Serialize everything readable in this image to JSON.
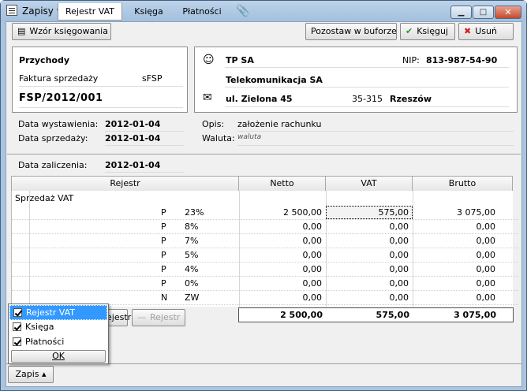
{
  "window": {
    "title": "Zapisy w buforze"
  },
  "toolbar": {
    "wzor": "Wzór księgowania",
    "pozostaw": "Pozostaw w buforze",
    "ksieguj": "Księguj",
    "usun": "Usuń"
  },
  "document": {
    "category": "Przychody",
    "type_label": "Faktura sprzedaży",
    "type_code": "sFSP",
    "number": "FSP/2012/001"
  },
  "contractor": {
    "name": "TP SA",
    "nip_label": "NIP:",
    "nip": "813-987-54-90",
    "full_name": "Telekomunikacja SA",
    "street": "ul. Zielona 45",
    "postal": "35-315",
    "city": "Rzeszów"
  },
  "dates": {
    "issue_label": "Data wystawienia:",
    "issue": "2012-01-04",
    "sale_label": "Data sprzedaży:",
    "sale": "2012-01-04",
    "booking_label": "Data zaliczenia:",
    "booking": "2012-01-04"
  },
  "meta": {
    "desc_label": "Opis:",
    "desc": "założenie rachunku",
    "currency_label": "Waluta:",
    "currency": "waluta"
  },
  "table": {
    "headers": {
      "rejestr": "Rejestr",
      "netto": "Netto",
      "vat": "VAT",
      "brutto": "Brutto"
    },
    "group": "Sprzedaż VAT",
    "rows": [
      {
        "flag": "P",
        "rate": "23%",
        "netto": "2 500,00",
        "vat": "575,00",
        "brutto": "3 075,00"
      },
      {
        "flag": "P",
        "rate": "8%",
        "netto": "0,00",
        "vat": "0,00",
        "brutto": "0,00"
      },
      {
        "flag": "P",
        "rate": "7%",
        "netto": "0,00",
        "vat": "0,00",
        "brutto": "0,00"
      },
      {
        "flag": "P",
        "rate": "5%",
        "netto": "0,00",
        "vat": "0,00",
        "brutto": "0,00"
      },
      {
        "flag": "P",
        "rate": "4%",
        "netto": "0,00",
        "vat": "0,00",
        "brutto": "0,00"
      },
      {
        "flag": "P",
        "rate": "0%",
        "netto": "0,00",
        "vat": "0,00",
        "brutto": "0,00"
      },
      {
        "flag": "N",
        "rate": "ZW",
        "netto": "0,00",
        "vat": "0,00",
        "brutto": "0,00"
      }
    ],
    "totals": {
      "netto": "2 500,00",
      "vat": "575,00",
      "brutto": "3 075,00"
    }
  },
  "actions": {
    "add_partial": "ejestr",
    "remove": "Rejestr"
  },
  "popup": {
    "items": [
      "Rejestr VAT",
      "Księga",
      "Płatności"
    ],
    "ok": "OK"
  },
  "tabs": {
    "zapis": "Zapis",
    "rejestr": "Rejestr VAT",
    "ksiega": "Księga",
    "platnosci": "Płatności"
  }
}
